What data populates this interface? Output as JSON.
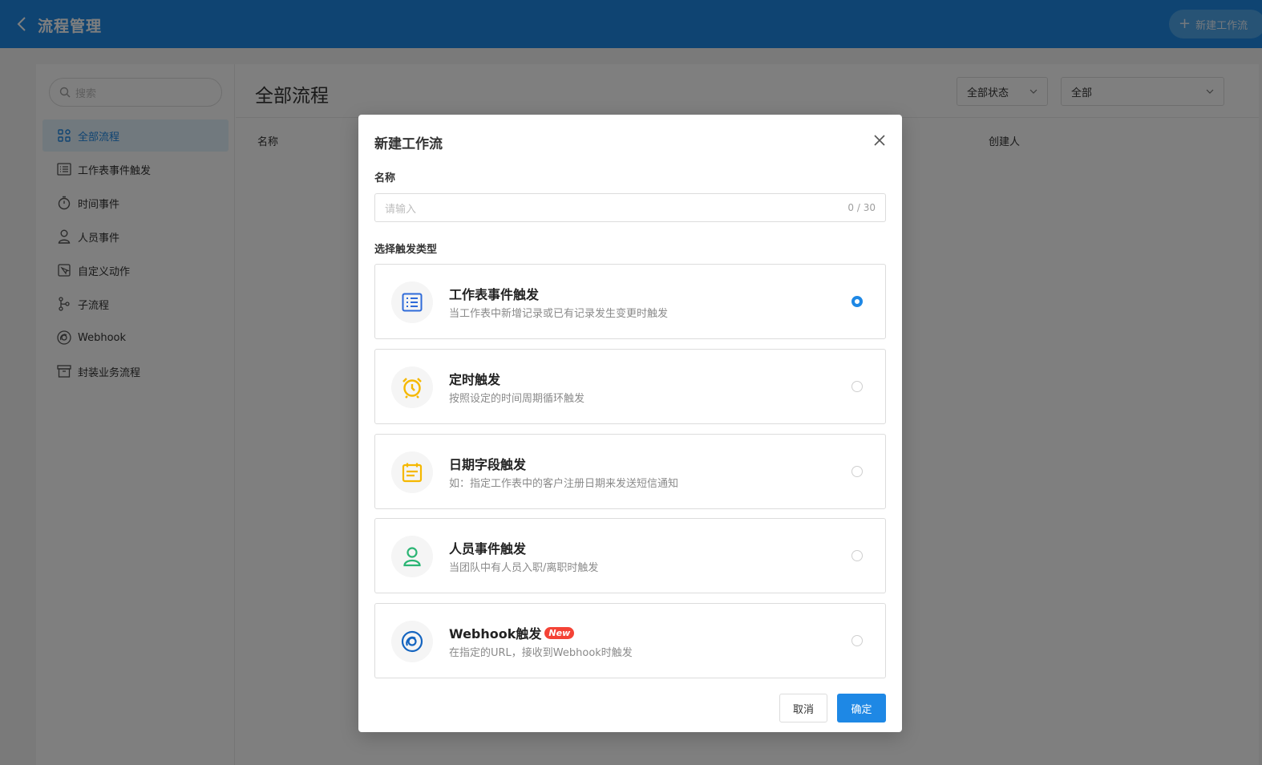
{
  "header": {
    "title": "流程管理",
    "new_button_label": "新建工作流"
  },
  "sidebar": {
    "search_placeholder": "搜索",
    "items": [
      {
        "label": "全部流程",
        "icon": "grid-icon",
        "active": true
      },
      {
        "label": "工作表事件触发",
        "icon": "list-icon",
        "active": false
      },
      {
        "label": "时间事件",
        "icon": "stopwatch-icon",
        "active": false
      },
      {
        "label": "人员事件",
        "icon": "person-icon",
        "active": false
      },
      {
        "label": "自定义动作",
        "icon": "cursor-icon",
        "active": false
      },
      {
        "label": "子流程",
        "icon": "branch-icon",
        "active": false
      },
      {
        "label": "Webhook",
        "icon": "webhook-icon",
        "active": false
      },
      {
        "label": "封装业务流程",
        "icon": "archive-icon",
        "active": false
      }
    ]
  },
  "main": {
    "title": "全部流程",
    "filter_status": "全部状态",
    "filter_all": "全部",
    "columns": [
      "名称",
      "创建人"
    ]
  },
  "dialog": {
    "title": "新建工作流",
    "name_label": "名称",
    "name_placeholder": "请输入",
    "name_counter": "0 / 30",
    "trigger_label": "选择触发类型",
    "options": [
      {
        "title": "工作表事件触发",
        "desc": "当工作表中新增记录或已有记录发生变更时触发",
        "icon": "worksheet-icon",
        "icon_color": "#2f6bd9",
        "selected": true
      },
      {
        "title": "定时触发",
        "desc": "按照设定的时间周期循环触发",
        "icon": "alarm-clock-icon",
        "icon_color": "#f5b800",
        "selected": false
      },
      {
        "title": "日期字段触发",
        "desc": "如：指定工作表中的客户注册日期来发送短信通知",
        "icon": "calendar-icon",
        "icon_color": "#f5b800",
        "selected": false
      },
      {
        "title": "人员事件触发",
        "desc": "当团队中有人员入职/离职时触发",
        "icon": "person-icon",
        "icon_color": "#2bb574",
        "selected": false
      },
      {
        "title": "Webhook触发",
        "desc": "在指定的URL，接收到Webhook时触发",
        "icon": "webhook-icon",
        "icon_color": "#1565c0",
        "selected": false,
        "badge": "New"
      }
    ],
    "cancel_label": "取消",
    "confirm_label": "确定"
  },
  "colors": {
    "accent": "#1e88e5",
    "badge": "#f44336"
  }
}
